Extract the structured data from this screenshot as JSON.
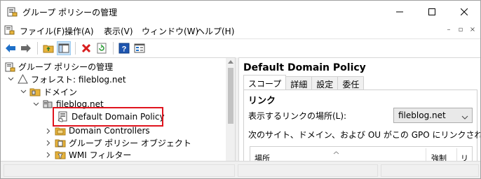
{
  "window": {
    "title": "グループ ポリシーの管理",
    "controls": [
      "minimize",
      "maximize",
      "close"
    ]
  },
  "menu": {
    "items": [
      "ファイル(F)",
      "操作(A)",
      "表示(V)",
      "ウィンドウ(W)",
      "ヘルプ(H)"
    ]
  },
  "toolbar": {
    "buttons": [
      "back-arrow-icon",
      "forward-arrow-icon",
      "up-folder-icon",
      "show-hide-tree-icon",
      "delete-icon",
      "refresh-icon",
      "help-icon",
      "properties-icon"
    ]
  },
  "tree": {
    "root": "グループ ポリシーの管理",
    "forest": "フォレスト: fileblog.net",
    "domains": "ドメイン",
    "domain": "fileblog.net",
    "selected": "Default Domain Policy",
    "children": [
      "Domain Controllers",
      "グループ ポリシー オブジェクト",
      "WMI フィルター"
    ]
  },
  "details": {
    "title": "Default Domain Policy",
    "tabs": [
      "スコープ",
      "詳細",
      "設定",
      "委任"
    ],
    "selected_tab": "スコープ",
    "section_title": "リンク",
    "location_label": "表示するリンクの場所(L):",
    "location_value": "fileblog.net",
    "info_text": "次のサイト、ドメイン、および OU がこの GPO にリンクされています(T):",
    "columns": [
      "場所",
      "強制",
      "リ"
    ]
  },
  "colors": {
    "highlight": "#e0141e",
    "selection_bg": "#cce4f7",
    "folder": "#e8b43c",
    "toolbar_blue": "#1e6fc8",
    "delete_red": "#d81e1e",
    "refresh_green": "#2f9e3a"
  }
}
